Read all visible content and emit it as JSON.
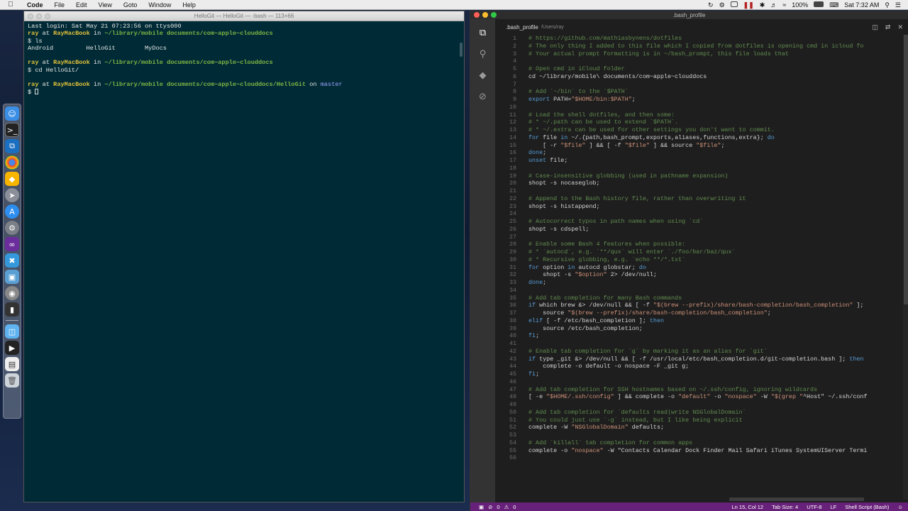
{
  "menubar": {
    "app_name": "Code",
    "items": [
      "File",
      "Edit",
      "View",
      "Goto",
      "Window",
      "Help"
    ],
    "battery": "100%",
    "clock": "Sat 7:32 AM"
  },
  "dock": {
    "icons": [
      "finder-icon",
      "terminal-icon",
      "vscode-icon",
      "chrome-icon",
      "sketch-icon",
      "launchpad-icon",
      "appstore-icon",
      "system-preferences-icon",
      "visual-studio-icon",
      "xamarin-icon",
      "monodevelop-icon",
      "photo-booth-icon",
      "screen-icon",
      "folder-icon",
      "movie-icon",
      "document-icon",
      "trash-icon"
    ]
  },
  "terminal": {
    "title": "HelloGit — HelloGit — -bash — 113×66",
    "last_login": "Last login: Sat May 21 07:23:56 on ttys000",
    "prompt_user": "ray",
    "prompt_host": "RayMacBook",
    "prompt_at": "at",
    "prompt_in": "in",
    "prompt_on": "on",
    "path1": "~/library/mobile documents/com~apple~clouddocs",
    "path2": "~/library/mobile documents/com~apple~clouddocs/HelloGit",
    "branch": "master",
    "cmd_ls": "$ ls",
    "ls_output": "Android         HelloGit        MyDocs",
    "cmd_cd": "$ cd HelloGit/",
    "prompt_dollar": "$"
  },
  "vscode": {
    "window_title": ".bash_profile",
    "tab_name": ".bash_profile",
    "tab_path": "/Users/ray",
    "status": {
      "errors": "0",
      "warnings": "0",
      "position": "Ln 15, Col 12",
      "tab_size": "Tab Size: 4",
      "encoding": "UTF-8",
      "eol": "LF",
      "language": "Shell Script (Bash)"
    },
    "code_lines": [
      "# https://github.com/mathiasbynens/dotfiles",
      "# The only thing I added to this file which I copied from dotfiles is opening cmd in icloud fo",
      "# Your actual prompt formatting is in ~/bash_prompt, this file loads that",
      "",
      "# Open cmd in iCloud folder",
      "cd ~/library/mobile\\ documents/com~apple~clouddocs",
      "",
      "# Add `~/bin` to the `$PATH`",
      "export PATH=\"$HOME/bin:$PATH\";",
      "",
      "# Load the shell dotfiles, and then some:",
      "# * ~/.path can be used to extend `$PATH`.",
      "# * ~/.extra can be used for other settings you don't want to commit.",
      "for file in ~/.{path,bash_prompt,exports,aliases,functions,extra}; do",
      "    [ -r \"$file\" ] && [ -f \"$file\" ] && source \"$file\";",
      "done;",
      "unset file;",
      "",
      "# Case-insensitive globbing (used in pathname expansion)",
      "shopt -s nocaseglob;",
      "",
      "# Append to the Bash history file, rather than overwriting it",
      "shopt -s histappend;",
      "",
      "# Autocorrect typos in path names when using `cd`",
      "shopt -s cdspell;",
      "",
      "# Enable some Bash 4 features when possible:",
      "# * `autocd`, e.g. `**/qux` will enter `./foo/bar/baz/qux`",
      "# * Recursive globbing, e.g. `echo **/*.txt`",
      "for option in autocd globstar; do",
      "    shopt -s \"$option\" 2> /dev/null;",
      "done;",
      "",
      "# Add tab completion for many Bash commands",
      "if which brew &> /dev/null && [ -f \"$(brew --prefix)/share/bash-completion/bash_completion\" ];",
      "    source \"$(brew --prefix)/share/bash-completion/bash_completion\";",
      "elif [ -f /etc/bash_completion ]; then",
      "    source /etc/bash_completion;",
      "fi;",
      "",
      "# Enable tab completion for `g` by marking it as an alias for `git`",
      "if type _git &> /dev/null && [ -f /usr/local/etc/bash_completion.d/git-completion.bash ]; then",
      "    complete -o default -o nospace -F _git g;",
      "fi;",
      "",
      "# Add tab completion for SSH hostnames based on ~/.ssh/config, ignoring wildcards",
      "[ -e \"$HOME/.ssh/config\" ] && complete -o \"default\" -o \"nospace\" -W \"$(grep \"^Host\" ~/.ssh/conf",
      "",
      "# Add tab completion for `defaults read|write NSGlobalDomain`",
      "# You could just use `-g` instead, but I like being explicit",
      "complete -W \"NSGlobalDomain\" defaults;",
      "",
      "# Add `killall` tab completion for common apps",
      "complete -o \"nospace\" -W \"Contacts Calendar Dock Finder Mail Safari iTunes SystemUIServer Termi",
      ""
    ]
  }
}
